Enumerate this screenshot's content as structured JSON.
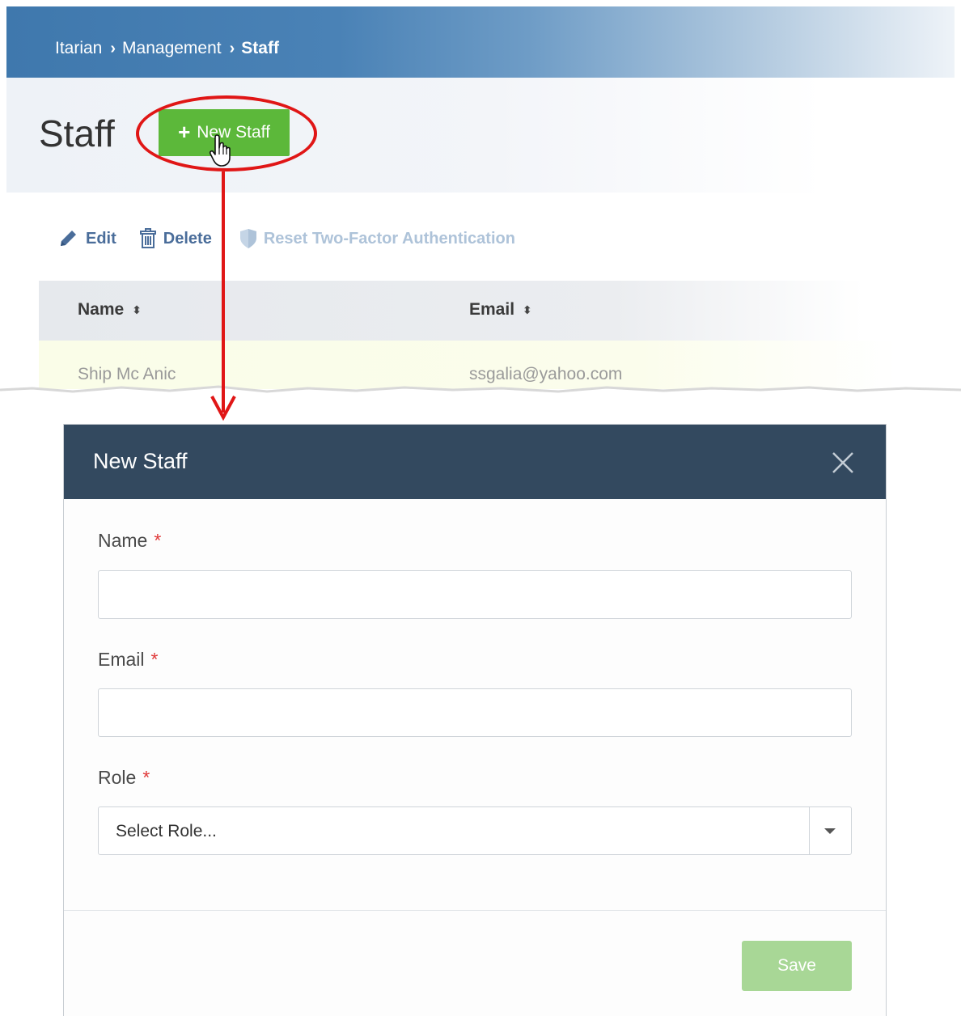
{
  "breadcrumb": {
    "root": "Itarian",
    "section": "Management",
    "current": "Staff"
  },
  "page": {
    "title": "Staff",
    "new_button_label": "New Staff"
  },
  "toolbar": {
    "edit_label": "Edit",
    "delete_label": "Delete",
    "reset_2fa_label": "Reset Two-Factor Authentication"
  },
  "table": {
    "columns": [
      "Name",
      "Email"
    ],
    "rows": [
      {
        "name": "Ship Mc Anic",
        "email": "ssgalia@yahoo.com"
      }
    ]
  },
  "modal": {
    "title": "New Staff",
    "fields": {
      "name_label": "Name",
      "email_label": "Email",
      "role_label": "Role",
      "required_mark": "*",
      "role_placeholder": "Select Role..."
    },
    "save_label": "Save"
  },
  "colors": {
    "header_blue": "#3f78ad",
    "new_button_green": "#5cb83a",
    "callout_red": "#e01616",
    "modal_header": "#33495f",
    "save_disabled_green": "#a8d796",
    "required_red": "#e03b3b"
  },
  "icons": [
    "pencil-icon",
    "trash-icon",
    "shield-icon",
    "sort-icon",
    "plus-icon",
    "hand-cursor-icon",
    "close-icon",
    "chevron-down-icon"
  ]
}
